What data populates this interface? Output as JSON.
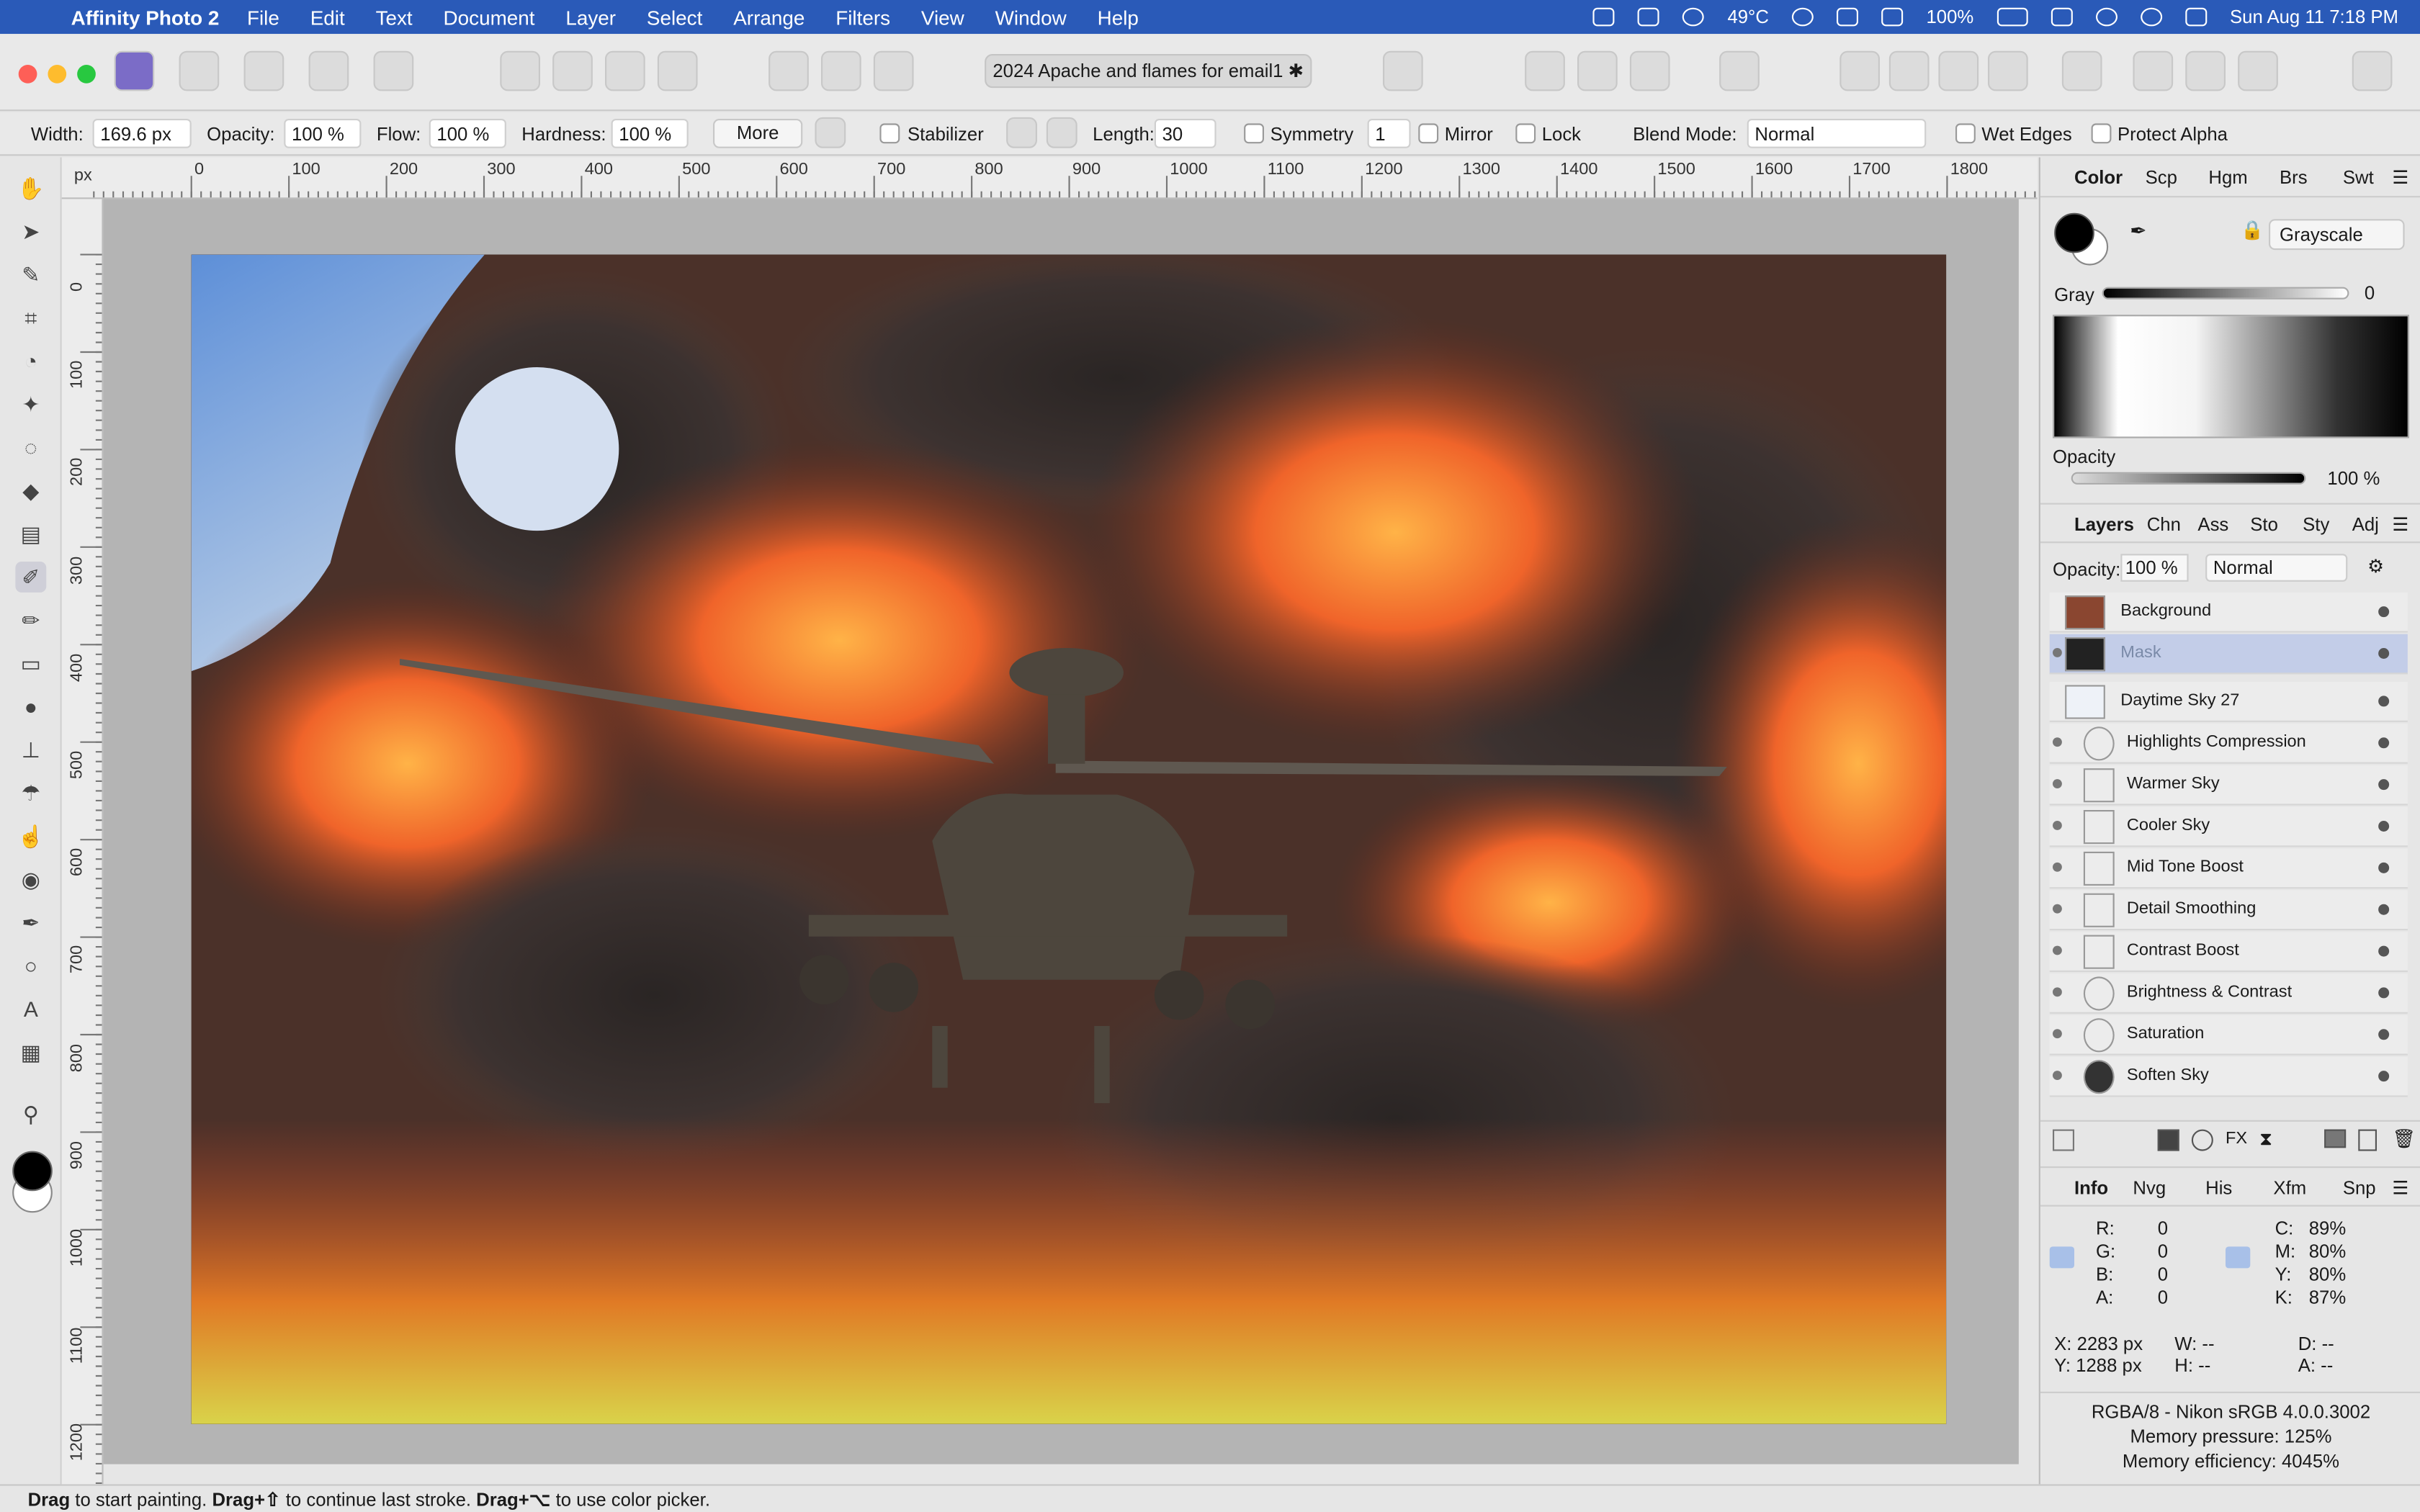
{
  "menubar": {
    "apple": "",
    "app_name": "Affinity Photo 2",
    "items": [
      "File",
      "Edit",
      "Text",
      "Document",
      "Layer",
      "Select",
      "Arrange",
      "Filters",
      "View",
      "Window",
      "Help"
    ],
    "temperature": "49°C",
    "battery": "100%",
    "datetime": "Sun Aug 11  7:18 PM"
  },
  "toolbar": {
    "document_title": "2024 Apache and flames for email1 ✱"
  },
  "context": {
    "width_label": "Width:",
    "width_value": "169.6 px",
    "opacity_label": "Opacity:",
    "opacity_value": "100 %",
    "flow_label": "Flow:",
    "flow_value": "100 %",
    "hardness_label": "Hardness:",
    "hardness_value": "100 %",
    "more_label": "More",
    "stabilizer_label": "Stabilizer",
    "length_label": "Length:",
    "length_value": "30",
    "symmetry_label": "Symmetry",
    "symmetry_value": "1",
    "mirror_label": "Mirror",
    "lock_label": "Lock",
    "blend_label": "Blend Mode:",
    "blend_value": "Normal",
    "wet_edges_label": "Wet Edges",
    "protect_alpha_label": "Protect Alpha"
  },
  "ruler": {
    "unit": "px",
    "h_labels": [
      "0",
      "100",
      "200",
      "300",
      "400",
      "500",
      "600",
      "700",
      "800",
      "900",
      "1000",
      "1100",
      "1200",
      "1300",
      "1400",
      "1500",
      "1600",
      "1700",
      "1800"
    ],
    "v_labels": [
      "0",
      "100",
      "200",
      "300",
      "400",
      "500",
      "600",
      "700",
      "800",
      "900",
      "1000",
      "1100",
      "1200"
    ]
  },
  "color_panel": {
    "tabs": [
      "Color",
      "Scp",
      "Hgm",
      "Brs",
      "Swt"
    ],
    "model": "Grayscale",
    "gray_label": "Gray",
    "gray_value": "0",
    "opacity_label": "Opacity",
    "opacity_value": "100 %"
  },
  "layers_panel": {
    "tabs": [
      "Layers",
      "Chn",
      "Ass",
      "Sto",
      "Sty",
      "Adj"
    ],
    "opacity_label": "Opacity:",
    "opacity_value": "100 %",
    "blend": "Normal",
    "layers": [
      "Background",
      "Mask",
      "Daytime Sky 27",
      "Highlights Compression",
      "Warmer Sky",
      "Cooler Sky",
      "Mid Tone Boost",
      "Detail Smoothing",
      "Contrast Boost",
      "Brightness & Contrast",
      "Saturation",
      "Soften Sky"
    ]
  },
  "info_panel": {
    "tabs": [
      "Info",
      "Nvg",
      "His",
      "Xfm",
      "Snp"
    ],
    "rgb": [
      {
        "k": "R:",
        "v": "0"
      },
      {
        "k": "G:",
        "v": "0"
      },
      {
        "k": "B:",
        "v": "0"
      },
      {
        "k": "A:",
        "v": "0"
      }
    ],
    "cmyk": [
      {
        "k": "C:",
        "v": "89%"
      },
      {
        "k": "M:",
        "v": "80%"
      },
      {
        "k": "Y:",
        "v": "80%"
      },
      {
        "k": "K:",
        "v": "87%"
      }
    ],
    "x": "X: 2283 px",
    "y": "Y: 1288 px",
    "w": "W: --",
    "h": "H: --",
    "d": "D: --",
    "a": "A: --",
    "profile": "RGBA/8 - Nikon sRGB 4.0.0.3002",
    "memory_pressure": "Memory pressure: 125%",
    "memory_efficiency": "Memory efficiency: 4045%"
  },
  "status": {
    "d1": "Drag",
    "t1": " to start painting. ",
    "d2": "Drag+⇧",
    "t2": " to continue last stroke. ",
    "d3": "Drag+⌥",
    "t3": " to use color picker."
  }
}
